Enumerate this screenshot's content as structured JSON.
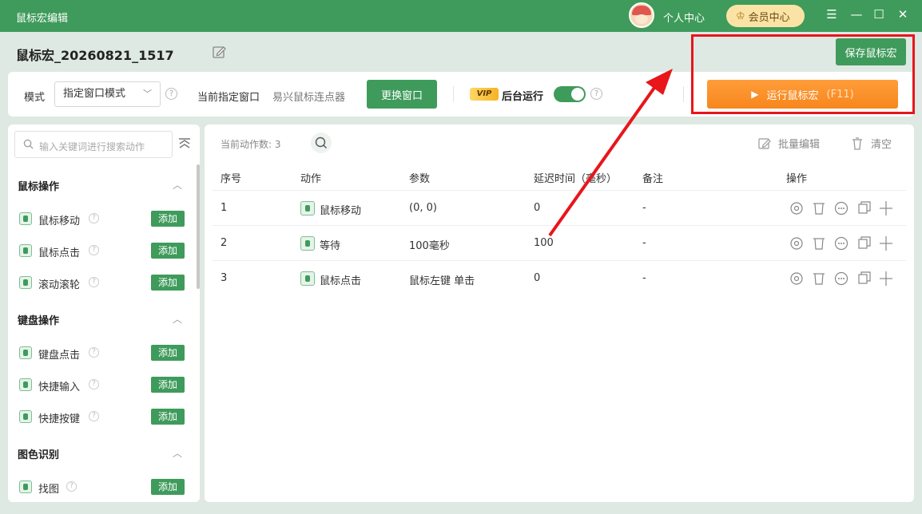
{
  "window": {
    "title": "鼠标宏编辑",
    "user_center": "个人中心",
    "vip_center": "会员中心"
  },
  "header": {
    "macro_name": "鼠标宏_20260821_1517",
    "save_label": "保存鼠标宏"
  },
  "toolbar": {
    "mode_label": "模式",
    "mode_value": "指定窗口模式",
    "current_window_label": "当前指定窗口",
    "current_window_value": "易兴鼠标连点器",
    "change_window_label": "更换窗口",
    "vip_badge": "VIP",
    "background_run_label": "后台运行",
    "background_run_enabled": true,
    "run_label": "运行鼠标宏",
    "run_hotkey": "(F11)"
  },
  "sidebar": {
    "search_placeholder": "输入关键词进行搜索动作",
    "add_label": "添加",
    "sections": [
      {
        "title": "鼠标操作",
        "items": [
          "鼠标移动",
          "鼠标点击",
          "滚动滚轮"
        ]
      },
      {
        "title": "键盘操作",
        "items": [
          "键盘点击",
          "快捷输入",
          "快捷按键"
        ]
      },
      {
        "title": "图色识别",
        "items": [
          "找图"
        ]
      }
    ]
  },
  "actions": {
    "count_label": "当前动作数:",
    "count": "3",
    "batch_edit_label": "批量编辑",
    "clear_label": "清空",
    "columns": [
      "序号",
      "动作",
      "参数",
      "延迟时间（毫秒）",
      "备注",
      "操作"
    ],
    "rows": [
      {
        "index": "1",
        "action": "鼠标移动",
        "params": "(0, 0)",
        "delay": "0",
        "note": "-"
      },
      {
        "index": "2",
        "action": "等待",
        "params": "100毫秒",
        "delay": "100",
        "note": "-"
      },
      {
        "index": "3",
        "action": "鼠标点击",
        "params": "鼠标左键 单击",
        "delay": "0",
        "note": "-"
      }
    ]
  },
  "colors": {
    "brand_green": "#3f9b5b",
    "run_orange": "#f7861d",
    "annotation_red": "#e8151b"
  }
}
